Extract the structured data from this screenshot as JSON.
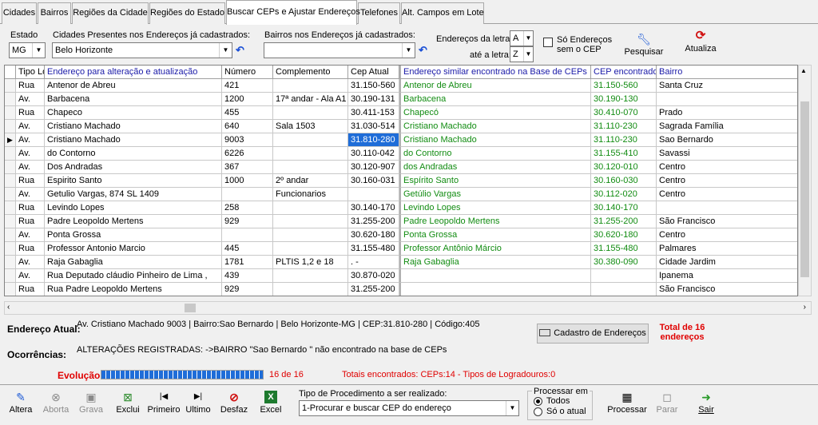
{
  "tabs": [
    "Cidades",
    "Bairros",
    "Regiões da Cidade",
    "Regiões do Estado",
    "Buscar CEPs e Ajustar Endereços",
    "Telefones",
    "Alt. Campos em Lote"
  ],
  "filters": {
    "estado_label": "Estado",
    "estado_value": "MG",
    "cidades_label": "Cidades Presentes nos Endereços já cadastrados:",
    "cidade_value": "Belo Horizonte",
    "bairros_label": "Bairros nos Endereços já cadastrados:",
    "bairro_value": "",
    "letra_de_label": "Endereços da letra:",
    "letra_de_value": "A",
    "letra_ate_label": "até a letra:",
    "letra_ate_value": "Z",
    "sem_cep_label_1": "Só Endereços",
    "sem_cep_label_2": "sem o CEP",
    "pesquisar_label": "Pesquisar",
    "atualiza_label": "Atualiza"
  },
  "grid": {
    "headers": [
      "Tipo Lo",
      "Endereço para alteração e atualização",
      "Número",
      "Complemento",
      "Cep Atual",
      "Endereço similar encontrado na Base de CEPs",
      "CEP encontrado",
      "Bairro"
    ],
    "rows": [
      [
        "Rua",
        "Antenor de Abreu",
        "421",
        "",
        "31.150-560",
        "Antenor de Abreu",
        "31.150-560",
        "Santa Cruz"
      ],
      [
        "Av.",
        "Barbacena",
        "1200",
        "17ª andar - Ala A1",
        "30.190-131",
        "Barbacena",
        "30.190-130",
        ""
      ],
      [
        "Rua",
        "Chapeco",
        "455",
        "",
        "30.411-153",
        "Chapecó",
        "30.410-070",
        "Prado"
      ],
      [
        "Av.",
        "Cristiano Machado",
        "640",
        "Sala 1503",
        "31.030-514",
        "Cristiano Machado",
        "31.110-230",
        "Sagrada Família"
      ],
      [
        "Av.",
        "Cristiano Machado",
        "9003",
        "",
        "31.810-280",
        "Cristiano Machado",
        "31.110-230",
        "Sao Bernardo"
      ],
      [
        "Av.",
        "do Contorno",
        "6226",
        "",
        "30.110-042",
        "do Contorno",
        "31.155-410",
        "Savassi"
      ],
      [
        "Av.",
        "Dos Andradas",
        "367",
        "",
        "30.120-907",
        "dos Andradas",
        "30.120-010",
        "Centro"
      ],
      [
        "Rua",
        "Espirito Santo",
        "1000",
        "2º andar",
        "30.160-031",
        "Espírito Santo",
        "30.160-030",
        "Centro"
      ],
      [
        "Av.",
        "Getulio Vargas, 874 SL 1409",
        "",
        "Funcionarios",
        "",
        "Getúlio Vargas",
        "30.112-020",
        "Centro"
      ],
      [
        "Rua",
        "Levindo Lopes",
        "258",
        "",
        "30.140-170",
        "Levindo Lopes",
        "30.140-170",
        ""
      ],
      [
        "Rua",
        "Padre Leopoldo Mertens",
        "929",
        "",
        "31.255-200",
        "Padre Leopoldo Mertens",
        "31.255-200",
        "São Francisco"
      ],
      [
        "Av.",
        "Ponta Grossa",
        "",
        "",
        "30.620-180",
        "Ponta Grossa",
        "30.620-180",
        "Centro"
      ],
      [
        "Rua",
        "Professor Antonio Marcio",
        "445",
        "",
        "31.155-480",
        "Professor Antônio Márcio",
        "31.155-480",
        "Palmares"
      ],
      [
        "Av.",
        "Raja Gabaglia",
        "1781",
        "PLTIS 1,2 e 18",
        "  .   -",
        "Raja Gabaglia",
        "30.380-090",
        "Cidade Jardim"
      ],
      [
        "Av.",
        "Rua Deputado cláudio Pinheiro de Lima ,",
        "439",
        "",
        "30.870-020",
        "",
        "",
        "Ipanema"
      ],
      [
        "Rua",
        "Rua Padre Leopoldo Mertens",
        "929",
        "",
        "31.255-200",
        "",
        "",
        "São Francisco"
      ]
    ],
    "selected_row": 4
  },
  "info": {
    "endereco_label": "Endereço Atual:",
    "endereco_value": "Av. Cristiano Machado  9003  | Bairro:Sao Bernardo  | Belo Horizonte-MG | CEP:31.810-280 | Código:405",
    "ocorrencias_label": "Ocorrências:",
    "ocorrencias_value": "ALTERAÇÕES REGISTRADAS:  ->BAIRRO \"Sao Bernardo \" não encontrado na base de CEPs",
    "cadastro_button": "Cadastro de Endereços",
    "total_line1": "Total de 16",
    "total_line2": "endereços"
  },
  "progress": {
    "label": "Evolução",
    "fraction": 1.0,
    "count_text": "16 de 16",
    "totais_text": "Totais encontrados: CEPs:14 - Tipos de Logradouros:0"
  },
  "toolbar": {
    "altera": "Altera",
    "aborta": "Aborta",
    "grava": "Grava",
    "exclui": "Exclui",
    "primeiro": "Primeiro",
    "ultimo": "Ultimo",
    "desfaz": "Desfaz",
    "excel": "Excel",
    "procedimento_label": "Tipo de Procedimento a ser realizado:",
    "procedimento_value": "1-Procurar e buscar CEP do endereço",
    "processar_em_label": "Processar em",
    "todos_label": "Todos",
    "so_atual_label": "Só o atual",
    "processar": "Processar",
    "parar": "Parar",
    "sair": "Sair"
  },
  "colors": {
    "green": "#128c12",
    "red": "#e00000",
    "selection": "#1f6dd8",
    "progress": "#1f6dd8"
  }
}
